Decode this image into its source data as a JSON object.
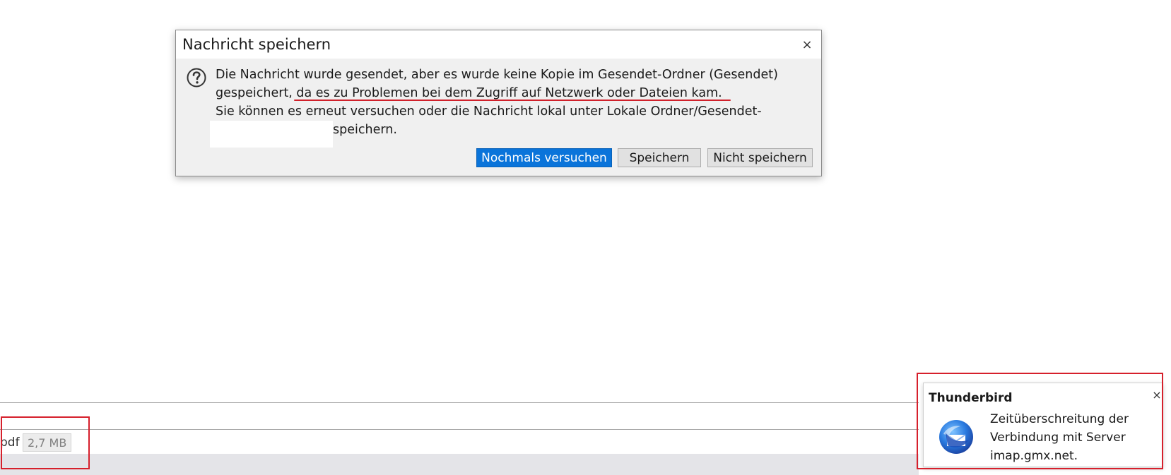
{
  "dialog": {
    "title": "Nachricht speichern",
    "close_glyph": "×",
    "icon": "question-icon",
    "message": {
      "line1": "Die Nachricht wurde gesendet, aber es wurde keine Kopie im Gesendet-Ordner (Gesendet)",
      "line2_prefix": "gespeichert,",
      "line2_underlined": " da es zu Problemen bei dem Zugriff auf Netzwerk oder Dateien kam.",
      "line3": "Sie können es erneut versuchen oder die Nachricht lokal unter Lokale Ordner/Gesendet-",
      "line4_suffix": "speichern."
    },
    "buttons": {
      "retry": "Nochmals versuchen",
      "save": "Speichern",
      "dont_save": "Nicht speichern"
    }
  },
  "attachment": {
    "name_fragment": "pdf",
    "size": "2,7 MB"
  },
  "notification": {
    "app": "Thunderbird",
    "close_glyph": "×",
    "icon": "thunderbird-logo",
    "message_lines": [
      "Zeitüberschreitung der",
      "Verbindung mit Server",
      "imap.gmx.net."
    ]
  },
  "colors": {
    "primary_button": "#0a74da",
    "annotation_red": "#d6202c"
  }
}
